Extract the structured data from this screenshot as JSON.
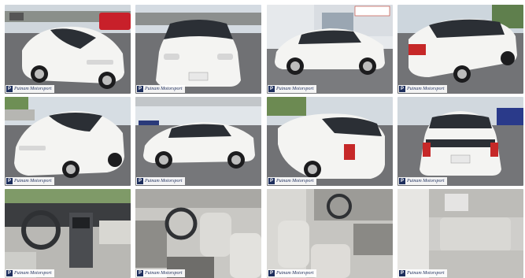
{
  "gallery": {
    "watermark": {
      "logo": "P",
      "text": "Putnam Motorsport"
    },
    "photos": [
      {
        "view": "front-three-quarter-left",
        "scene": "dealer-lot"
      },
      {
        "view": "front",
        "scene": "dealer-lot"
      },
      {
        "view": "side-right",
        "scene": "dealership-building"
      },
      {
        "view": "rear-three-quarter-left",
        "scene": "dealer-lot"
      },
      {
        "view": "front-three-quarter-right",
        "scene": "dealer-lot"
      },
      {
        "view": "side-right",
        "scene": "dealer-lot"
      },
      {
        "view": "rear-three-quarter-right",
        "scene": "dealer-lot"
      },
      {
        "view": "rear",
        "scene": "dealer-lot"
      },
      {
        "view": "dashboard",
        "scene": "interior"
      },
      {
        "view": "driver-seat",
        "scene": "interior"
      },
      {
        "view": "passenger-seat",
        "scene": "interior"
      },
      {
        "view": "rear-seats",
        "scene": "interior"
      }
    ],
    "colors": {
      "car": "#f4f4f2",
      "sky": "#dfe6ee",
      "asphalt": "#6e6f72",
      "interior": "#cfcfcc"
    }
  }
}
